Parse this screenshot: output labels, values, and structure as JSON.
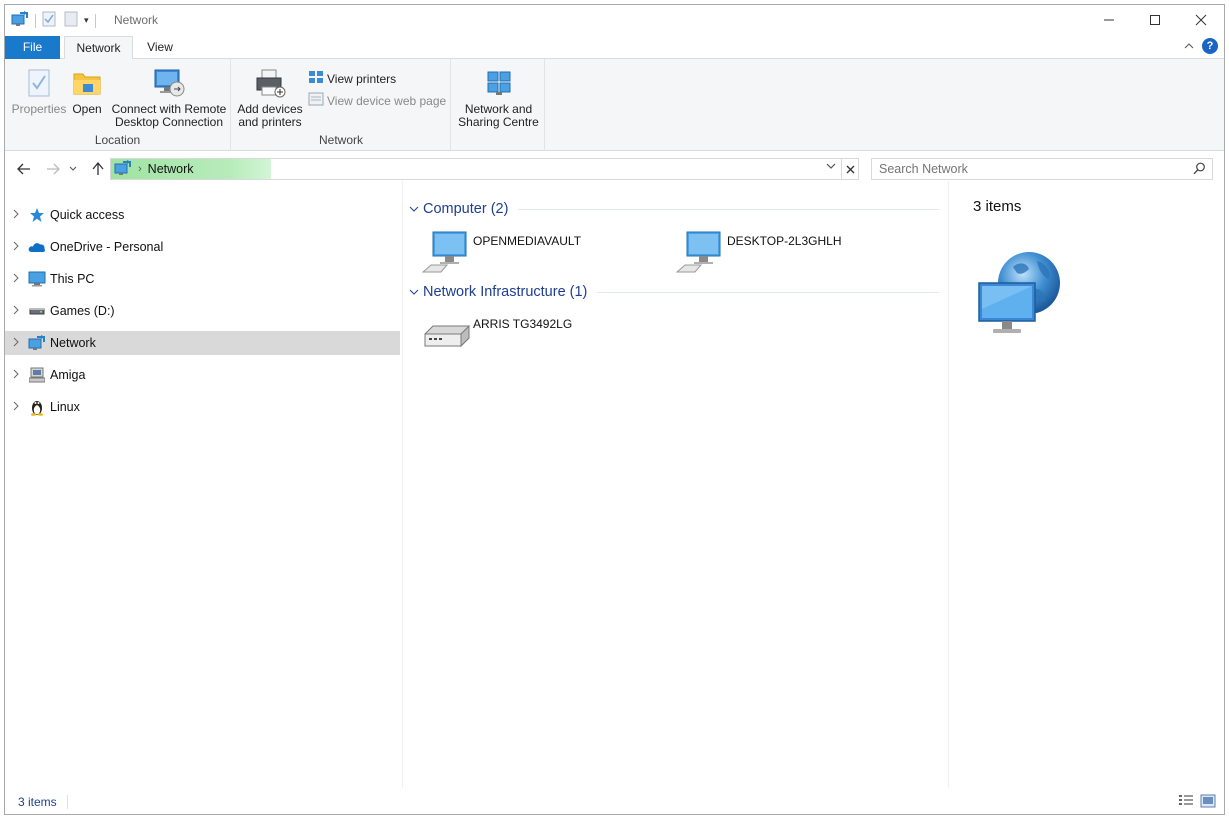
{
  "window": {
    "title": "Network",
    "controls": [
      "minimize",
      "maximize",
      "close"
    ]
  },
  "ribbon": {
    "tabs": [
      {
        "label": "File",
        "active": false
      },
      {
        "label": "Network",
        "active": true
      },
      {
        "label": "View",
        "active": false
      }
    ],
    "groups": [
      {
        "label": "Location",
        "buttons": [
          {
            "label": "Properties",
            "icon": "properties-icon",
            "enabled": false
          },
          {
            "label": "Open",
            "icon": "folder-open-icon",
            "enabled": true
          },
          {
            "label_line1": "Connect with Remote",
            "label_line2": "Desktop Connection",
            "icon": "remote-desktop-icon",
            "enabled": true
          }
        ]
      },
      {
        "label": "Network",
        "buttons": [
          {
            "label_line1": "Add devices",
            "label_line2": "and printers",
            "icon": "add-printer-icon",
            "enabled": true
          }
        ],
        "small_buttons": [
          {
            "label": "View printers",
            "icon": "printers-icon",
            "enabled": true
          },
          {
            "label": "View device web page",
            "icon": "web-page-icon",
            "enabled": false
          }
        ]
      },
      {
        "label": "",
        "buttons": [
          {
            "label_line1": "Network and",
            "label_line2": "Sharing Centre",
            "icon": "sharing-centre-icon",
            "enabled": true
          }
        ]
      }
    ]
  },
  "address": {
    "location": "Network",
    "search_placeholder": "Search Network"
  },
  "nav_pane": {
    "items": [
      {
        "label": "Quick access",
        "icon": "star-icon",
        "selected": false
      },
      {
        "label": "OneDrive - Personal",
        "icon": "cloud-icon",
        "selected": false
      },
      {
        "label": "This PC",
        "icon": "monitor-icon",
        "selected": false
      },
      {
        "label": "Games (D:)",
        "icon": "drive-icon",
        "selected": false
      },
      {
        "label": "Network",
        "icon": "network-icon",
        "selected": true
      },
      {
        "label": "Amiga",
        "icon": "computer-folder-icon",
        "selected": false
      },
      {
        "label": "Linux",
        "icon": "penguin-icon",
        "selected": false
      }
    ]
  },
  "content": {
    "groups": [
      {
        "title": "Computer (2)",
        "items": [
          {
            "name": "OPENMEDIAVAULT",
            "icon": "computer-icon"
          },
          {
            "name": "DESKTOP-2L3GHLH",
            "icon": "computer-icon"
          }
        ]
      },
      {
        "title": "Network Infrastructure (1)",
        "items": [
          {
            "name": "ARRIS TG3492LG",
            "icon": "router-icon"
          }
        ]
      }
    ]
  },
  "details": {
    "count": "3 items",
    "icon": "network-globe-icon"
  },
  "status": {
    "count": "3 items",
    "view_buttons": [
      "details-view-icon",
      "large-icons-view-icon"
    ]
  },
  "colors": {
    "accent": "#1979ca",
    "group_header": "#1e3f8f",
    "selection": "#d9d9d9",
    "ribbon_bg": "#f5f6f7"
  }
}
